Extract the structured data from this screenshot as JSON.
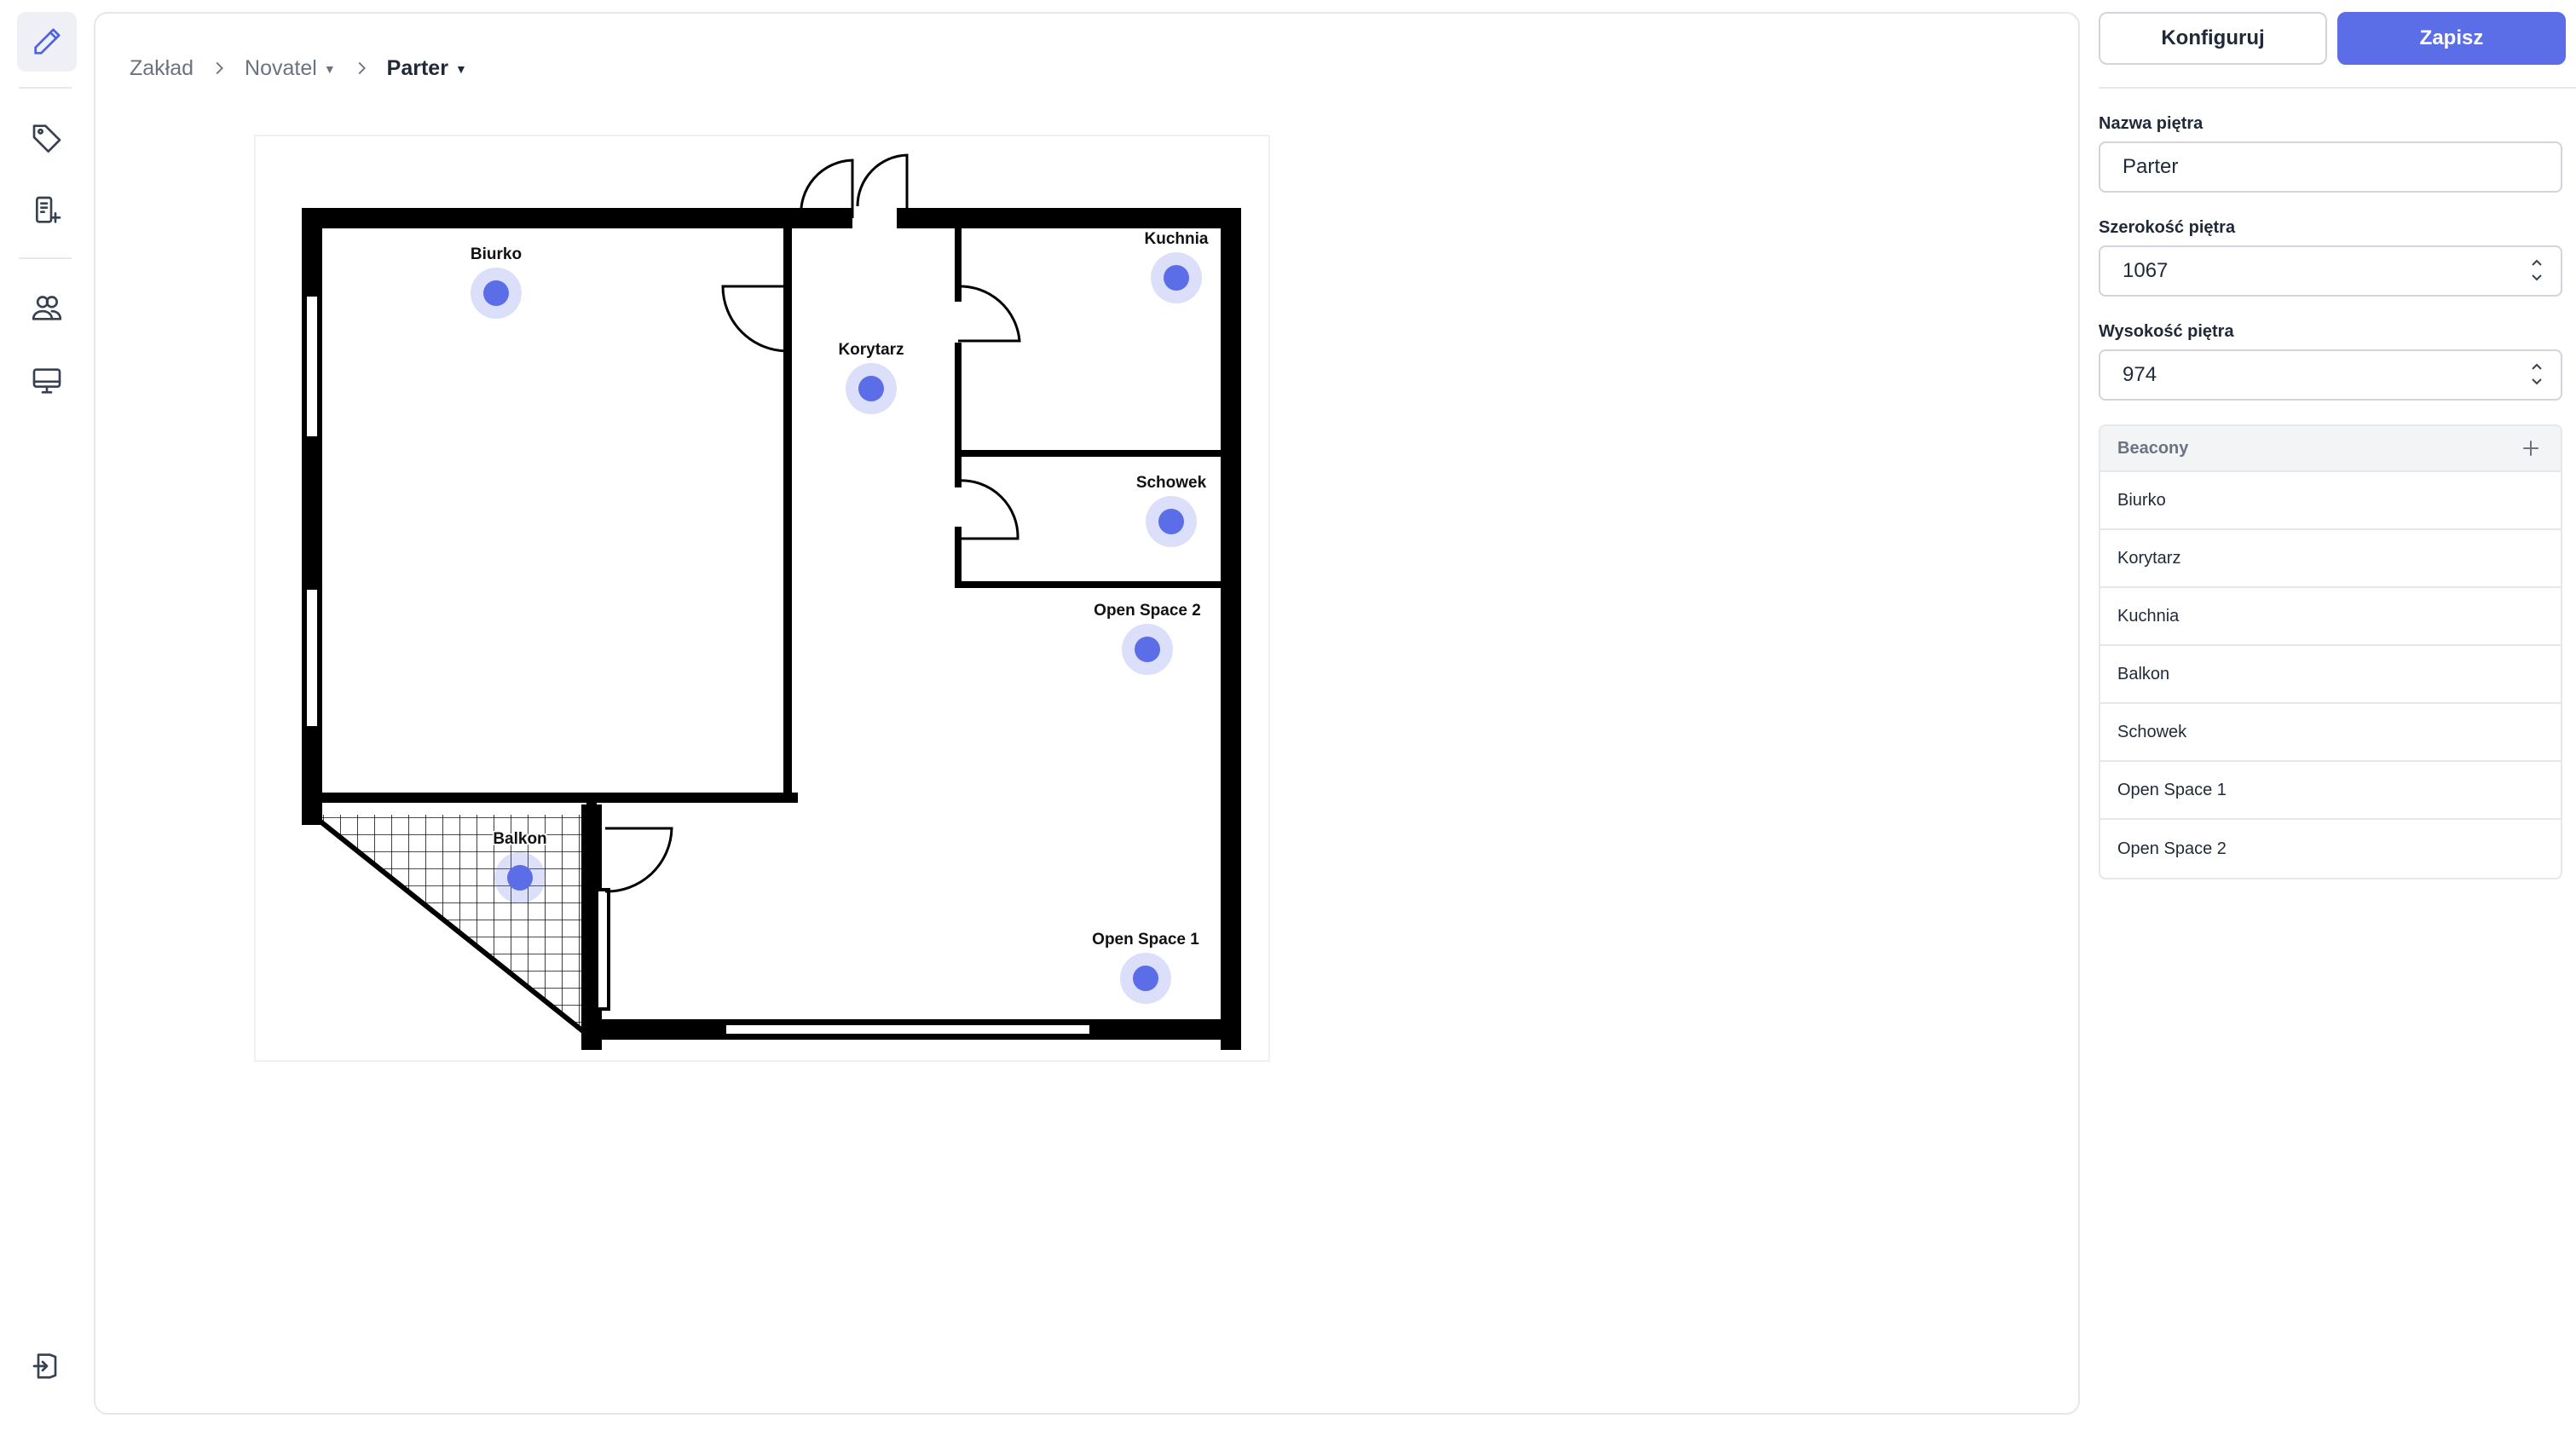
{
  "rail": {
    "top_items": [
      {
        "name": "edit-pencil-icon",
        "active": true
      },
      {
        "name": "tag-icon",
        "active": false
      },
      {
        "name": "add-device-icon",
        "active": false
      }
    ],
    "mid_items": [
      {
        "name": "users-icon",
        "active": false
      },
      {
        "name": "monitor-icon",
        "active": false
      }
    ],
    "bottom_item": {
      "name": "logout-icon"
    }
  },
  "breadcrumb": {
    "root": "Zakład",
    "building": "Novatel",
    "floor": "Parter"
  },
  "floorplan": {
    "beacons": [
      {
        "label": "Biurko",
        "x": 0.2341,
        "y": 0.0,
        "label_name": "Biurko"
      },
      {
        "label": "Korytarz"
      },
      {
        "label": "Kuchnia"
      },
      {
        "label": "Schowek"
      },
      {
        "label": "Open Space 2"
      },
      {
        "label": "Balkon"
      },
      {
        "label": "Open Space 1"
      }
    ],
    "accent_color": "#5b6ee8"
  },
  "toolbar": {
    "configure_label": "Konfiguruj",
    "save_label": "Zapisz"
  },
  "form": {
    "name_label": "Nazwa piętra",
    "name_value": "Parter",
    "width_label": "Szerokość piętra",
    "width_value": "1067",
    "height_label": "Wysokość piętra",
    "height_value": "974"
  },
  "beacon_list": {
    "title": "Beacony",
    "items": [
      "Biurko",
      "Korytarz",
      "Kuchnia",
      "Balkon",
      "Schowek",
      "Open Space 1",
      "Open Space 2"
    ]
  }
}
